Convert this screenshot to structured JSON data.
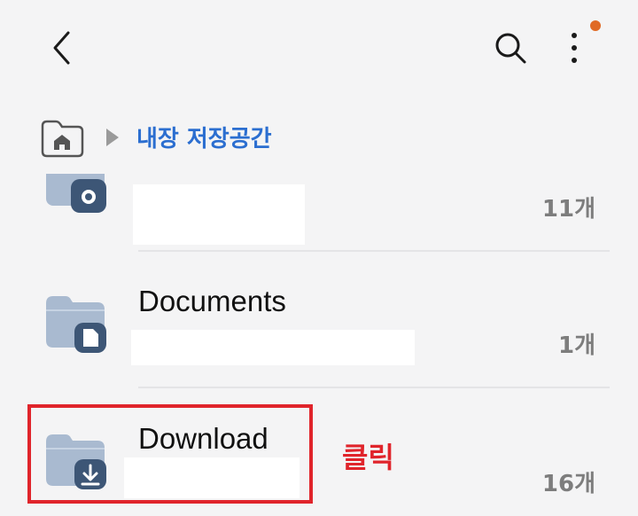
{
  "header": {
    "back_icon": "chevron-left-icon",
    "search_icon": "search-icon",
    "more_icon": "more-vertical-icon",
    "notification_color": "#e06a25"
  },
  "breadcrumb": {
    "home_icon": "home-folder-icon",
    "separator_icon": "triangle-right-icon",
    "current": "내장 저장공간",
    "current_color": "#2b6ed0"
  },
  "folders": [
    {
      "name": "",
      "count": "11개",
      "icon": "folder-camera-icon"
    },
    {
      "name": "Documents",
      "count": "1개",
      "icon": "folder-document-icon"
    },
    {
      "name": "Download",
      "count": "16개",
      "icon": "folder-download-icon"
    }
  ],
  "annotation": {
    "label": "클릭",
    "color": "#e0242b"
  }
}
